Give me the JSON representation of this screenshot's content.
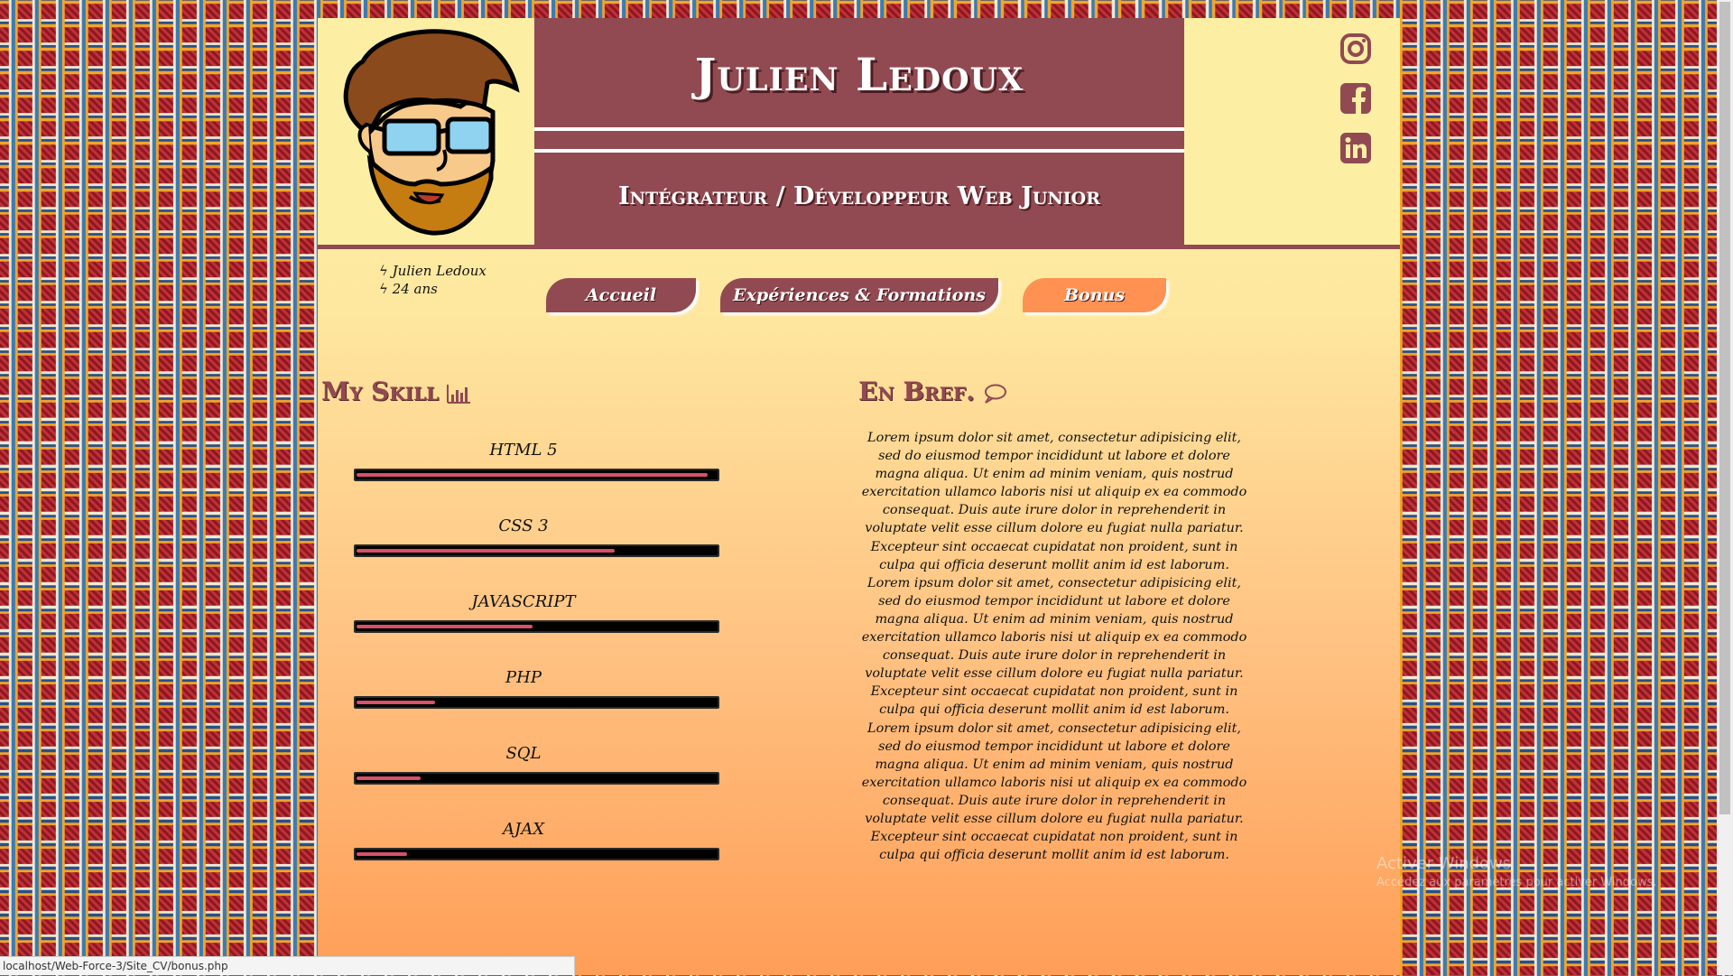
{
  "header": {
    "name": "Julien Ledoux",
    "job_title": "Intégrateur / Développeur Web Junior",
    "avatar_icon": "cartoon-avatar",
    "social": [
      {
        "icon": "instagram-icon"
      },
      {
        "icon": "facebook-icon"
      },
      {
        "icon": "linkedin-icon"
      }
    ]
  },
  "infos": {
    "name": "ϟ Julien Ledoux",
    "age": "ϟ 24 ans"
  },
  "nav": {
    "items": [
      {
        "label": "Accueil"
      },
      {
        "label": "Expériences & Formations"
      },
      {
        "label": "Bonus"
      }
    ],
    "active": "Bonus"
  },
  "skills": {
    "title": "My Skill",
    "icon": "bar-chart-icon",
    "items": [
      {
        "label": "HTML 5",
        "level": 0.98
      },
      {
        "label": "CSS 3",
        "level": 0.72
      },
      {
        "label": "JAVASCRIPT",
        "level": 0.49
      },
      {
        "label": "PHP",
        "level": 0.22
      },
      {
        "label": "SQL",
        "level": 0.18
      },
      {
        "label": "AJAX",
        "level": 0.14
      }
    ]
  },
  "bref": {
    "title": "En Bref.",
    "icon": "speech-bubble-icon",
    "text": "Lorem ipsum dolor sit amet, consectetur adipisicing elit, sed do eiusmod tempor incididunt ut labore et dolore magna aliqua. Ut enim ad minim veniam, quis nostrud exercitation ullamco laboris nisi ut aliquip ex ea commodo consequat. Duis aute irure dolor in reprehenderit in voluptate velit esse cillum dolore eu fugiat nulla pariatur. Excepteur sint occaecat cupidatat non proident, sunt in culpa qui officia deserunt mollit anim id est laborum. Lorem ipsum dolor sit amet, consectetur adipisicing elit, sed do eiusmod tempor incididunt ut labore et dolore magna aliqua. Ut enim ad minim veniam, quis nostrud exercitation ullamco laboris nisi ut aliquip ex ea commodo consequat. Duis aute irure dolor in reprehenderit in voluptate velit esse cillum dolore eu fugiat nulla pariatur. Excepteur sint occaecat cupidatat non proident, sunt in culpa qui officia deserunt mollit anim id est laborum. Lorem ipsum dolor sit amet, consectetur adipisicing elit, sed do eiusmod tempor incididunt ut labore et dolore magna aliqua. Ut enim ad minim veniam, quis nostrud exercitation ullamco laboris nisi ut aliquip ex ea commodo consequat. Duis aute irure dolor in reprehenderit in voluptate velit esse cillum dolore eu fugiat nulla pariatur. Excepteur sint occaecat cupidatat non proident, sunt in culpa qui officia deserunt mollit anim id est laborum."
  },
  "browser": {
    "status_url": "localhost/Web-Force-3/Site_CV/bonus.php"
  },
  "watermark": {
    "line1": "Activer Windows",
    "line2": "Accédez aux paramètres pour activer Windows."
  },
  "colors": {
    "primary": "#914a52",
    "accent": "#ff9152",
    "bar_fill": "#d8506a",
    "header_bg": "#fcefa4"
  }
}
